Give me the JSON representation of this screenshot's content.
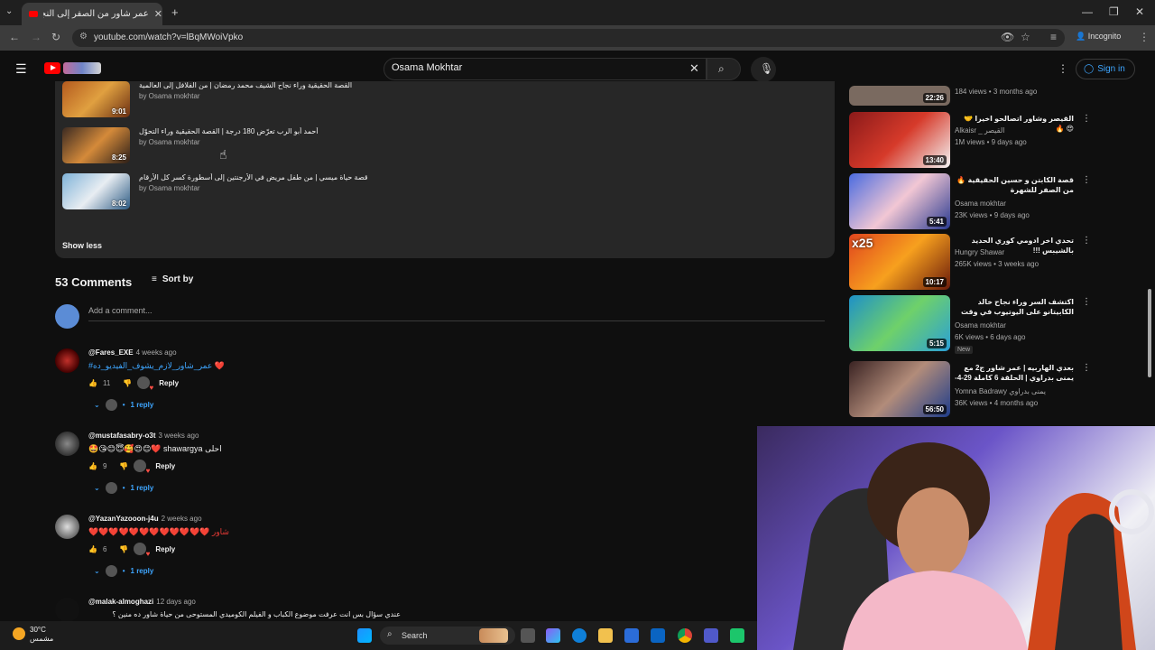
{
  "browser": {
    "tab_title": "عمر شاور من الصفر إلى النجومية",
    "url": "youtube.com/watch?v=lBqMWoiVpko",
    "incognito_label": "Incognito"
  },
  "youtube": {
    "search_query": "Osama Mokhtar",
    "signin_label": "Sign in"
  },
  "description_videos": [
    {
      "title": "القصة الحقيقية وراء نجاح الشيف محمد رمضان | من الفلافل إلى العالمية",
      "channel": "by Osama mokhtar",
      "duration": "9:01"
    },
    {
      "title": "أحمد أبو الرب تعرّض 180 درجة | القصة الحقيقية وراء التحوّل",
      "channel": "by Osama mokhtar",
      "duration": "8:25"
    },
    {
      "title": "قصة حياة ميسي | من طفل مريض في الأرجنتين إلى أسطورة كسر كل الأرقام",
      "channel": "by Osama mokhtar",
      "duration": "8:02"
    }
  ],
  "show_less_label": "Show less",
  "comments_header": {
    "count_label": "53 Comments",
    "sort_label": "Sort by"
  },
  "add_comment_placeholder": "Add a comment...",
  "comments": [
    {
      "user": "@Fares_EXE",
      "when": "4 weeks ago",
      "text": "#عمر_شاور_لازم_يشوف_الفيديو_ده ❤️",
      "likes": "11",
      "reply_label": "Reply",
      "replies_label": "1 reply"
    },
    {
      "user": "@mustafasabry-o3t",
      "when": "3 weeks ago",
      "text": "🤩😘😊😇🥰😍😊❤️ shawargya احلى",
      "likes": "9",
      "reply_label": "Reply",
      "replies_label": "1 reply"
    },
    {
      "user": "@YazanYazooon-j4u",
      "when": "2 weeks ago",
      "text": "❤️❤️❤️❤️❤️❤️❤️❤️❤️❤️❤️❤️ شاور",
      "likes": "6",
      "reply_label": "Reply",
      "replies_label": "1 reply"
    },
    {
      "user": "@malak-almoghazi",
      "when": "12 days ago",
      "text": "عندي سؤال بس انت عرفت موضوع الكباب و الفيلم الكوميدي المستوحى من حياة شاور ده منين ؟",
      "likes": "",
      "reply_label": "",
      "replies_label": ""
    }
  ],
  "sidebar": [
    {
      "title": "",
      "channel": "",
      "meta": "184 views • 3 months ago",
      "duration": "22:26",
      "color": "#7a6a60"
    },
    {
      "title": "القيصر وشاور اتصالحو اخيرا 🤝 😍 🔥",
      "channel": "Alkaisr _ القيصر",
      "meta": "1M views • 9 days ago",
      "duration": "13:40",
      "color": "#c0392b"
    },
    {
      "title": "قصة الكابتن و حسين الحقيقية 🔥 من الصفر للشهرة",
      "channel": "Osama mokhtar",
      "meta": "23K views • 9 days ago",
      "duration": "5:41",
      "color": "#3b5bd0"
    },
    {
      "title": "تحدي اخر ادومي كوري الحديد بالشيبس !!!",
      "channel": "Hungry Shawar",
      "meta": "265K views • 3 weeks ago",
      "duration": "10:17",
      "color": "#e0451e",
      "badge": "x25"
    },
    {
      "title": "اكتشف السر وراء نجاح خالد الكابيتانو على اليوتيوب في وقت قصير",
      "channel": "Osama mokhtar",
      "meta": "6K views • 6 days ago",
      "duration": "5:15",
      "color": "#2a9fd6",
      "new": "New"
    },
    {
      "title": "بعدي الهاربيه | عمر شاور ج2 مع يمنى بدراوي | الحلقة 6 كاملة 29-4-2025",
      "channel": "Yomna Badrawy يمنى بدراوي",
      "meta": "36K views • 4 months ago",
      "duration": "56:50",
      "color": "#5a3b3b"
    }
  ],
  "taskbar": {
    "temp": "30°C",
    "weather_text": "مشمس",
    "search_label": "Search"
  }
}
